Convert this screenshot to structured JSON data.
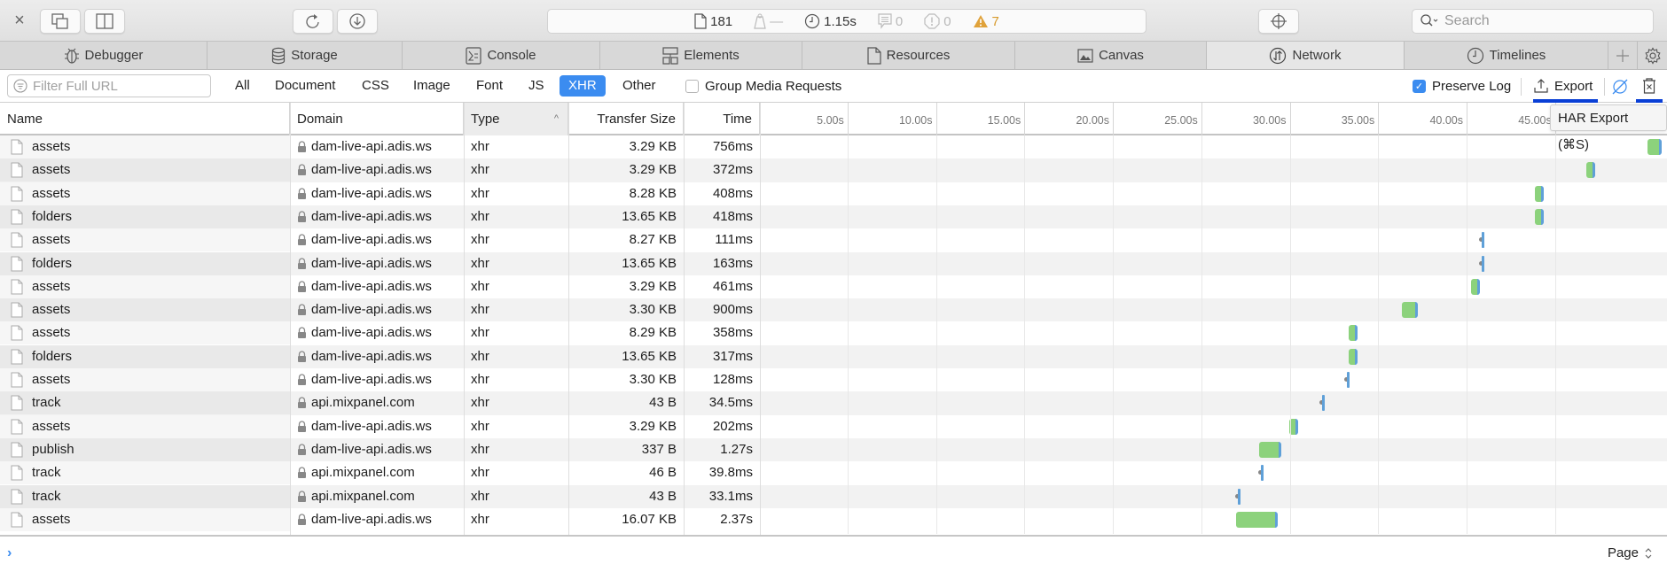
{
  "toolbar": {
    "close_label": "×",
    "activity": {
      "resources_count": "181",
      "size": "—",
      "load_time": "1.15s",
      "logs": "0",
      "errors": "0",
      "warnings": "7"
    },
    "search_placeholder": "Search"
  },
  "tabs": [
    {
      "label": "Debugger",
      "icon": "bug-icon"
    },
    {
      "label": "Storage",
      "icon": "database-icon"
    },
    {
      "label": "Console",
      "icon": "console-icon"
    },
    {
      "label": "Elements",
      "icon": "elements-icon"
    },
    {
      "label": "Resources",
      "icon": "document-icon"
    },
    {
      "label": "Canvas",
      "icon": "image-icon"
    },
    {
      "label": "Network",
      "icon": "network-icon",
      "active": true
    },
    {
      "label": "Timelines",
      "icon": "clock-icon"
    }
  ],
  "filter": {
    "placeholder": "Filter Full URL",
    "types": [
      "All",
      "Document",
      "CSS",
      "Image",
      "Font",
      "JS",
      "XHR",
      "Other"
    ],
    "active_type": "XHR",
    "group_media_label": "Group Media Requests",
    "group_media_checked": false,
    "preserve_log_label": "Preserve Log",
    "preserve_log_checked": true,
    "export_label": "Export"
  },
  "tooltip": "HAR Export (⌘S)",
  "table": {
    "columns": {
      "name": "Name",
      "domain": "Domain",
      "type": "Type",
      "size": "Transfer Size",
      "time": "Time"
    },
    "sort_indicator": "^",
    "ticks": [
      "5.00s",
      "10.00s",
      "15.00s",
      "20.00s",
      "25.00s",
      "30.00s",
      "35.00s",
      "40.00s",
      "45.00s"
    ],
    "rows": [
      {
        "name": "assets",
        "domain": "dam-live-api.adis.ws",
        "type": "xhr",
        "size": "3.29 KB",
        "time": "756ms",
        "start_s": 50.2,
        "duration_s": 0.756
      },
      {
        "name": "assets",
        "domain": "dam-live-api.adis.ws",
        "type": "xhr",
        "size": "3.29 KB",
        "time": "372ms",
        "start_s": 46.7,
        "duration_s": 0.372
      },
      {
        "name": "assets",
        "domain": "dam-live-api.adis.ws",
        "type": "xhr",
        "size": "8.28 KB",
        "time": "408ms",
        "start_s": 43.8,
        "duration_s": 0.408
      },
      {
        "name": "folders",
        "domain": "dam-live-api.adis.ws",
        "type": "xhr",
        "size": "13.65 KB",
        "time": "418ms",
        "start_s": 43.8,
        "duration_s": 0.418
      },
      {
        "name": "assets",
        "domain": "dam-live-api.adis.ws",
        "type": "xhr",
        "size": "8.27 KB",
        "time": "111ms",
        "start_s": 40.8,
        "duration_s": 0.111
      },
      {
        "name": "folders",
        "domain": "dam-live-api.adis.ws",
        "type": "xhr",
        "size": "13.65 KB",
        "time": "163ms",
        "start_s": 40.8,
        "duration_s": 0.163
      },
      {
        "name": "assets",
        "domain": "dam-live-api.adis.ws",
        "type": "xhr",
        "size": "3.29 KB",
        "time": "461ms",
        "start_s": 40.2,
        "duration_s": 0.461
      },
      {
        "name": "assets",
        "domain": "dam-live-api.adis.ws",
        "type": "xhr",
        "size": "3.30 KB",
        "time": "900ms",
        "start_s": 36.3,
        "duration_s": 0.9
      },
      {
        "name": "assets",
        "domain": "dam-live-api.adis.ws",
        "type": "xhr",
        "size": "8.29 KB",
        "time": "358ms",
        "start_s": 33.3,
        "duration_s": 0.358
      },
      {
        "name": "folders",
        "domain": "dam-live-api.adis.ws",
        "type": "xhr",
        "size": "13.65 KB",
        "time": "317ms",
        "start_s": 33.3,
        "duration_s": 0.317
      },
      {
        "name": "assets",
        "domain": "dam-live-api.adis.ws",
        "type": "xhr",
        "size": "3.30 KB",
        "time": "128ms",
        "start_s": 33.2,
        "duration_s": 0.128
      },
      {
        "name": "track",
        "domain": "api.mixpanel.com",
        "type": "xhr",
        "size": "43 B",
        "time": "34.5ms",
        "start_s": 31.8,
        "duration_s": 0.0345
      },
      {
        "name": "assets",
        "domain": "dam-live-api.adis.ws",
        "type": "xhr",
        "size": "3.29 KB",
        "time": "202ms",
        "start_s": 29.9,
        "duration_s": 0.202
      },
      {
        "name": "publish",
        "domain": "dam-live-api.adis.ws",
        "type": "xhr",
        "size": "337 B",
        "time": "1.27s",
        "start_s": 28.2,
        "duration_s": 1.27
      },
      {
        "name": "track",
        "domain": "api.mixpanel.com",
        "type": "xhr",
        "size": "46 B",
        "time": "39.8ms",
        "start_s": 28.3,
        "duration_s": 0.0398
      },
      {
        "name": "track",
        "domain": "api.mixpanel.com",
        "type": "xhr",
        "size": "43 B",
        "time": "33.1ms",
        "start_s": 27.0,
        "duration_s": 0.0331
      },
      {
        "name": "assets",
        "domain": "dam-live-api.adis.ws",
        "type": "xhr",
        "size": "16.07 KB",
        "time": "2.37s",
        "start_s": 26.9,
        "duration_s": 2.37
      }
    ]
  },
  "console": {
    "prompt": "›",
    "page_selector": "Page"
  },
  "colors": {
    "accent": "#3b8cf0",
    "bar_receive": "#8cd27c",
    "bar_wait": "#5fa0d8",
    "warning": "#d79a2a"
  }
}
